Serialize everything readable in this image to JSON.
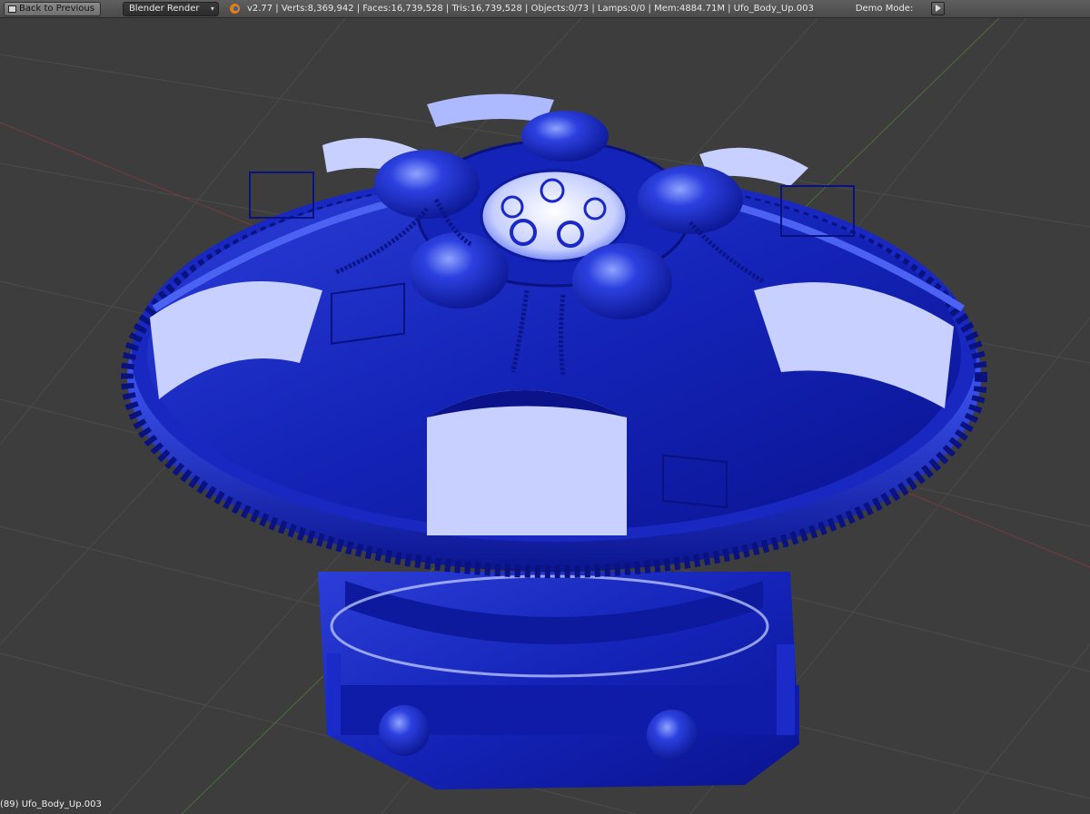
{
  "header": {
    "back_label": "Back to Previous",
    "engine_label": "Blender Render",
    "stats": "v2.77 | Verts:8,369,942 | Faces:16,739,528 | Tris:16,739,528 | Objects:0/73 | Lamps:0/0 | Mem:4884.71M | Ufo_Body_Up.003",
    "demo_label": "Demo Mode:"
  },
  "viewport": {
    "object_label": "(89) Ufo_Body_Up.003",
    "model_color": "#1a28c8",
    "background_color": "#3d3d3d",
    "grid_color": "#4a4a4a"
  },
  "icons": [
    "back-icon",
    "blender-logo-icon",
    "play-icon",
    "dropdown-arrow-icon"
  ]
}
